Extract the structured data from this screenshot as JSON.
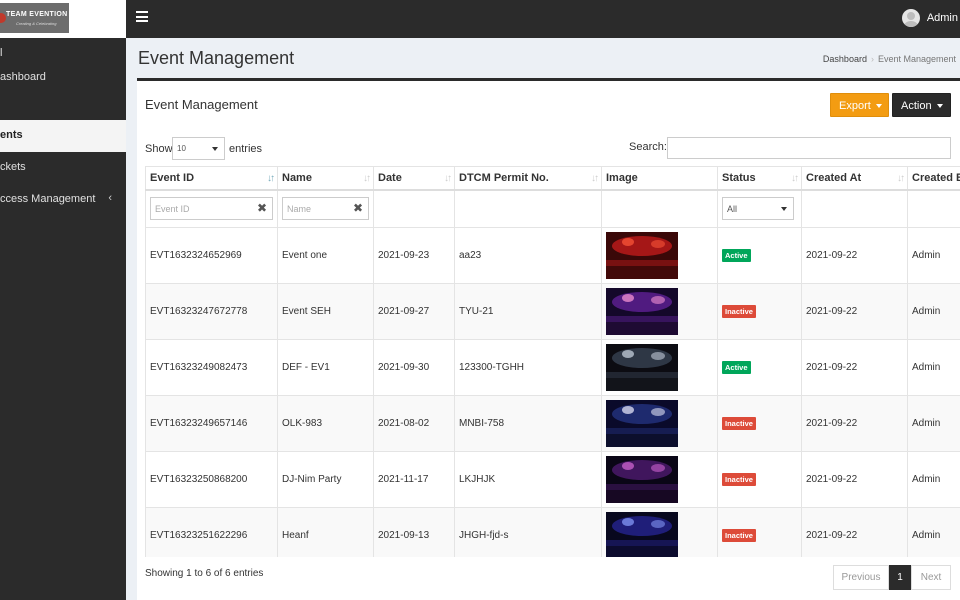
{
  "brand": {
    "name": "TEAM EVENTION",
    "tagline": "Creating & Celebrating"
  },
  "sidebar": {
    "items": [
      {
        "label": "l",
        "active": false
      },
      {
        "label": "ashboard",
        "active": false
      },
      {
        "label": "ents",
        "active": true
      },
      {
        "label": "ckets",
        "active": false
      },
      {
        "label": "ccess Management",
        "active": false,
        "chevron": "‹"
      }
    ]
  },
  "header": {
    "user_name": "Admin"
  },
  "page": {
    "title": "Event Management",
    "breadcrumb": [
      "Dashboard",
      "Event Management"
    ],
    "breadcrumb_sep": "›"
  },
  "box": {
    "title": "Event Management",
    "export_label": "Export",
    "action_label": "Action",
    "show_label": "Show",
    "entries_label": "entries",
    "page_length": "10",
    "search_label": "Search:",
    "search_value": ""
  },
  "table": {
    "columns": [
      "Event ID",
      "Name",
      "Date",
      "DTCM Permit No.",
      "Image",
      "Status",
      "Created At",
      "Created B"
    ],
    "filters": {
      "event_id_placeholder": "Event ID",
      "name_placeholder": "Name",
      "status_value": "All",
      "clear_glyph": "✖"
    },
    "rows": [
      {
        "id": "EVT1632324652969",
        "name": "Event one",
        "date": "2021-09-23",
        "permit": "aa23",
        "status": "Active",
        "created_at": "2021-09-22",
        "created_by": "Admin"
      },
      {
        "id": "EVT16323247672778",
        "name": "Event SEH",
        "date": "2021-09-27",
        "permit": "TYU-21",
        "status": "Inactive",
        "created_at": "2021-09-22",
        "created_by": "Admin"
      },
      {
        "id": "EVT16323249082473",
        "name": "DEF - EV1",
        "date": "2021-09-30",
        "permit": "123300-TGHH",
        "status": "Active",
        "created_at": "2021-09-22",
        "created_by": "Admin"
      },
      {
        "id": "EVT16323249657146",
        "name": "OLK-983",
        "date": "2021-08-02",
        "permit": "MNBI-758",
        "status": "Inactive",
        "created_at": "2021-09-22",
        "created_by": "Admin"
      },
      {
        "id": "EVT16323250868200",
        "name": "DJ-Nim Party",
        "date": "2021-11-17",
        "permit": "LKJHJK",
        "status": "Inactive",
        "created_at": "2021-09-22",
        "created_by": "Admin"
      },
      {
        "id": "EVT16323251622296",
        "name": "Heanf",
        "date": "2021-09-13",
        "permit": "JHGH-fjd-s",
        "status": "Inactive",
        "created_at": "2021-09-22",
        "created_by": "Admin"
      }
    ]
  },
  "footer": {
    "info": "Showing 1 to 6 of 6 entries",
    "previous_label": "Previous",
    "current_page": "1",
    "next_label": "Next"
  },
  "colors": {
    "sidebar_bg": "#2b2b2b",
    "export_btn": "#f39c12",
    "badge_active": "#00a65a",
    "badge_inactive": "#dd4b39"
  },
  "icons": {
    "menu": "hamburger-icon",
    "sort": "sort-icon",
    "clear": "clear-icon",
    "caret": "caret-down-icon",
    "avatar": "user-avatar-icon"
  }
}
